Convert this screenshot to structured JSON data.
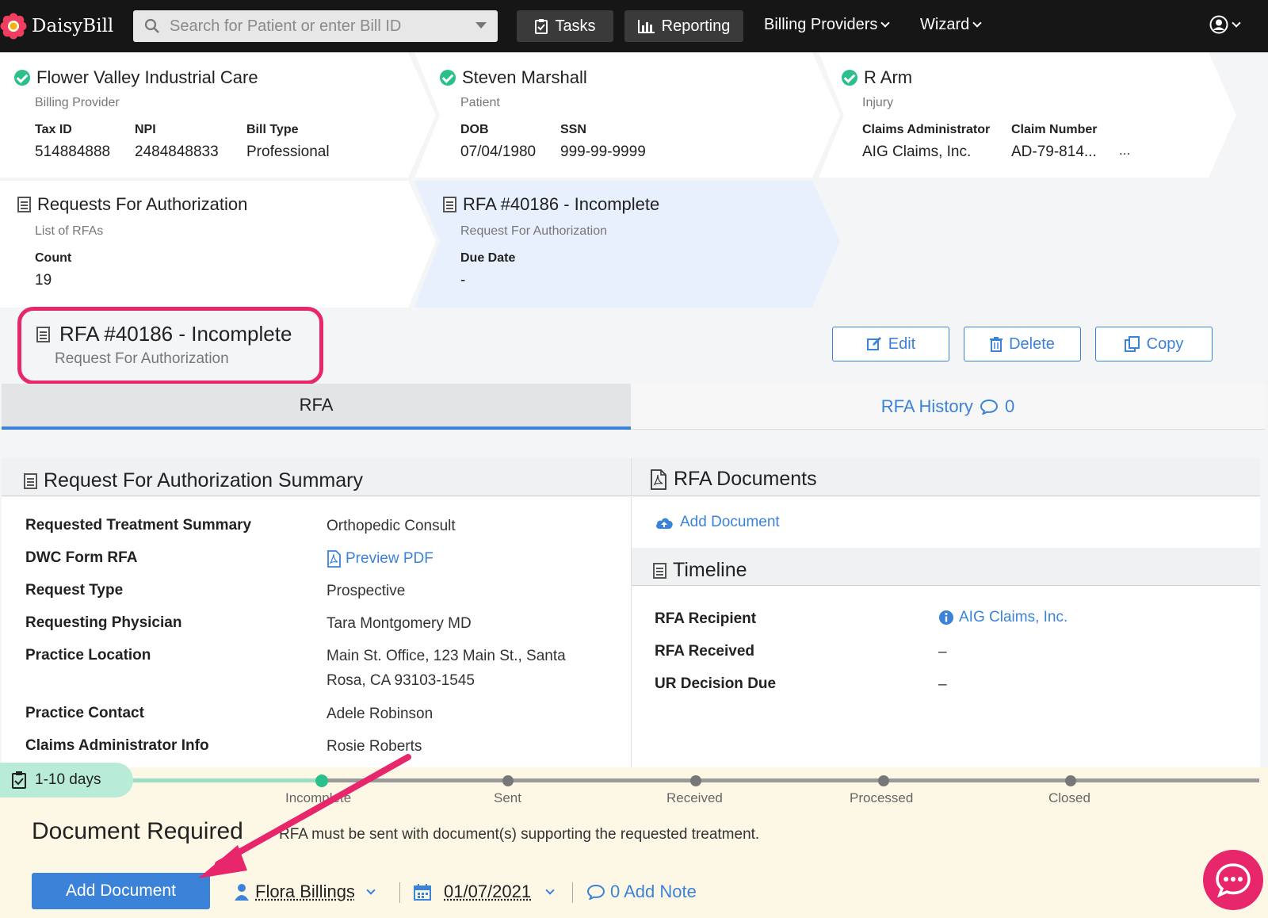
{
  "nav": {
    "logo": "DaisyBill",
    "search_placeholder": "Search for Patient or enter Bill ID",
    "tasks": "Tasks",
    "reporting": "Reporting",
    "billing_providers": "Billing Providers",
    "wizard": "Wizard"
  },
  "cards": {
    "provider": {
      "name": "Flower Valley Industrial Care",
      "type": "Billing Provider",
      "tax_id_label": "Tax ID",
      "tax_id": "514884888",
      "npi_label": "NPI",
      "npi": "2484848833",
      "bill_type_label": "Bill Type",
      "bill_type": "Professional"
    },
    "patient": {
      "name": "Steven Marshall",
      "type": "Patient",
      "dob_label": "DOB",
      "dob": "07/04/1980",
      "ssn_label": "SSN",
      "ssn": "999-99-9999"
    },
    "injury": {
      "name": "R Arm",
      "type": "Injury",
      "admin_label": "Claims Administrator",
      "admin": "AIG Claims, Inc.",
      "claim_label": "Claim Number",
      "claim": "AD-79-814...",
      "more": "..."
    },
    "rfa_list": {
      "title": "Requests For Authorization",
      "sub": "List of RFAs",
      "count_label": "Count",
      "count": "19"
    },
    "rfa_current": {
      "title": "RFA #40186 - Incomplete",
      "sub": "Request For Authorization",
      "due_label": "Due Date",
      "due": "-"
    }
  },
  "header": {
    "title": "RFA #40186 - Incomplete",
    "sub": "Request For Authorization",
    "edit": "Edit",
    "delete": "Delete",
    "copy": "Copy"
  },
  "tabs": {
    "rfa": "RFA",
    "history": "RFA History",
    "history_count": "0"
  },
  "summary": {
    "heading": "Request For Authorization Summary",
    "rows": [
      {
        "label": "Requested Treatment Summary",
        "value": "Orthopedic Consult"
      },
      {
        "label": "DWC Form RFA",
        "value": "Preview PDF"
      },
      {
        "label": "Request Type",
        "value": "Prospective"
      },
      {
        "label": "Requesting Physician",
        "value": "Tara Montgomery MD"
      },
      {
        "label": "Practice Location",
        "value": "Main St. Office, 123 Main St., Santa Rosa, CA 93103-1545"
      },
      {
        "label": "Practice Contact",
        "value": "Adele Robinson"
      },
      {
        "label": "Claims Administrator Info",
        "value": "Rosie Roberts"
      }
    ]
  },
  "documents": {
    "heading": "RFA Documents",
    "add": "Add Document"
  },
  "timeline": {
    "heading": "Timeline",
    "rows": [
      {
        "label": "RFA Recipient",
        "value": "AIG Claims, Inc."
      },
      {
        "label": "RFA Received",
        "value": "–"
      },
      {
        "label": "UR Decision Due",
        "value": "–"
      }
    ]
  },
  "status": {
    "badge": "1-10 days",
    "steps": [
      "Incomplete",
      "Sent",
      "Received",
      "Processed",
      "Closed"
    ],
    "heading": "Document Required",
    "message": "RFA must be sent with document(s) supporting the requested treatment.",
    "add_document": "Add Document",
    "assignee": "Flora Billings",
    "date": "01/07/2021",
    "note": "0 Add Note"
  },
  "colors": {
    "accent": "#3b82d9",
    "highlight": "#e8266b",
    "success": "#2bbf8a",
    "nav_bg": "#161616"
  }
}
